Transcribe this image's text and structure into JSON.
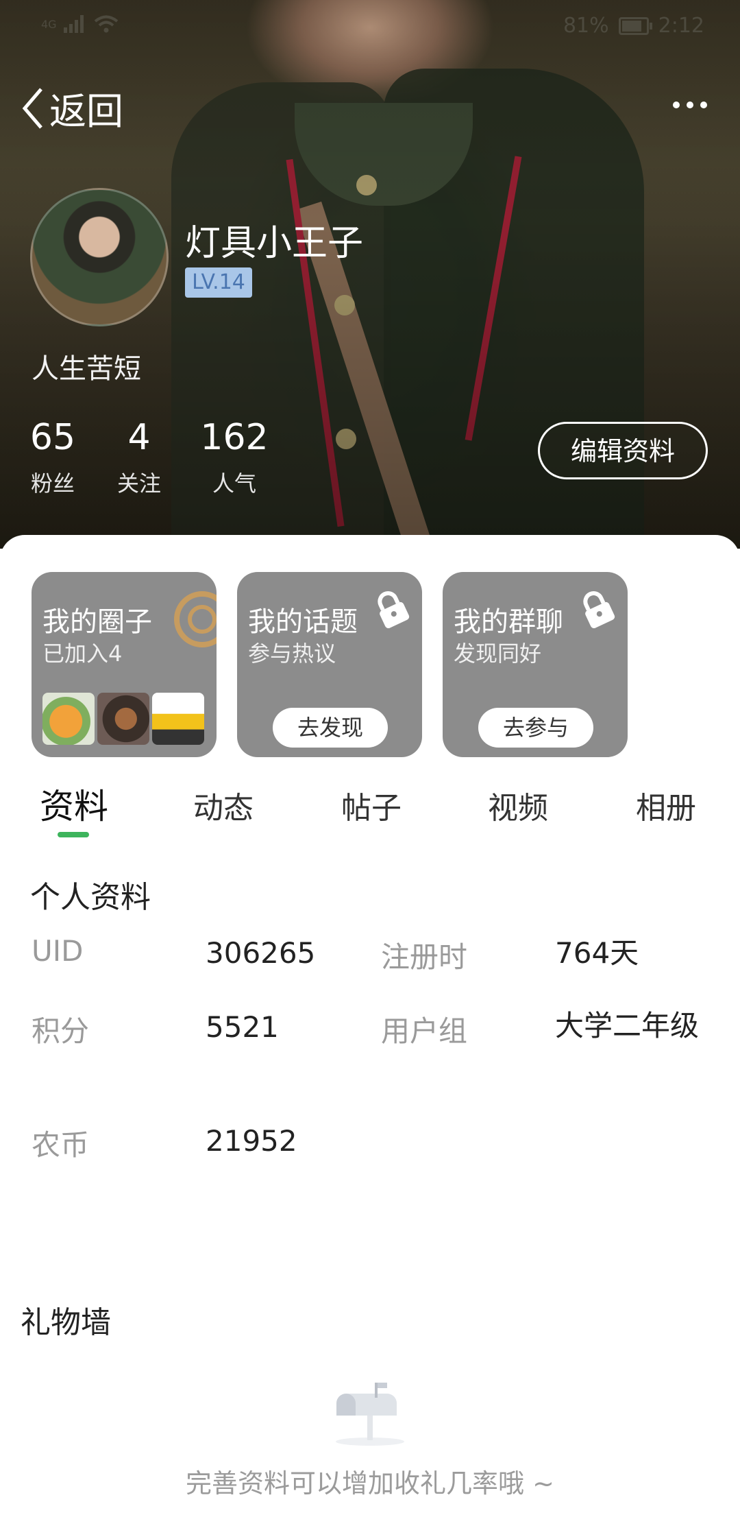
{
  "status_bar": {
    "network": "4G",
    "battery": "81%",
    "battery_level": 0.81,
    "time": "2:12"
  },
  "header": {
    "back_label": "返回"
  },
  "profile": {
    "username": "灯具小王子",
    "level": "LV.14",
    "bio": "人生苦短",
    "stats": [
      {
        "value": "65",
        "label": "粉丝"
      },
      {
        "value": "4",
        "label": "关注"
      },
      {
        "value": "162",
        "label": "人气"
      }
    ],
    "edit_label": "编辑资料"
  },
  "cards": [
    {
      "title": "我的圈子",
      "subtitle": "已加入4"
    },
    {
      "title": "我的话题",
      "subtitle": "参与热议",
      "button": "去发现"
    },
    {
      "title": "我的群聊",
      "subtitle": "发现同好",
      "button": "去参与"
    }
  ],
  "tabs": [
    "资料",
    "动态",
    "帖子",
    "视频",
    "相册"
  ],
  "active_tab": "资料",
  "accent_color": "#3db45c",
  "info": {
    "title": "个人资料",
    "uid_label": "UID",
    "uid_value": "306265",
    "reg_label": "注册时",
    "reg_value": "764天",
    "points_label": "积分",
    "points_value": "5521",
    "group_label": "用户组",
    "group_value": "大学二年级",
    "coin_label": "农币",
    "coin_value": "21952"
  },
  "gift_wall": {
    "title": "礼物墙",
    "empty_hint": "完善资料可以增加收礼几率哦 ~"
  }
}
